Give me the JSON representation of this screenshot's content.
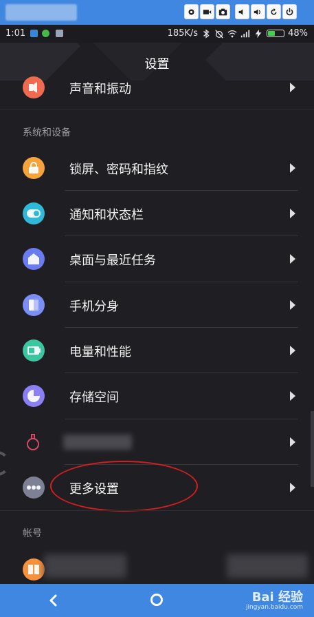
{
  "status_bar": {
    "time": "1:01",
    "network_speed": "185K/s",
    "battery_percent": "48%",
    "battery_level": 0.48
  },
  "header": {
    "title": "设置"
  },
  "items_top": [
    {
      "label": "声音和振动",
      "icon": "speaker-icon",
      "color": "#f06a4f"
    }
  ],
  "sections": [
    {
      "title": "系统和设备",
      "items": [
        {
          "label": "锁屏、密码和指纹",
          "icon": "lock-icon",
          "color": "#f7a33b"
        },
        {
          "label": "通知和状态栏",
          "icon": "toggle-icon",
          "color": "#2fb8d8"
        },
        {
          "label": "桌面与最近任务",
          "icon": "home-icon",
          "color": "#6a7cf0"
        },
        {
          "label": "手机分身",
          "icon": "dual-phone-icon",
          "color": "#7a8ef5"
        },
        {
          "label": "电量和性能",
          "icon": "battery-icon",
          "color": "#3cc6a0"
        },
        {
          "label": "存储空间",
          "icon": "pie-icon",
          "color": "#8a7ff5"
        },
        {
          "label": "",
          "icon": "flask-icon",
          "color": "#d44a6a"
        },
        {
          "label": "更多设置",
          "icon": "more-dots-icon",
          "color": "#7e8094"
        }
      ]
    },
    {
      "title": "帐号"
    }
  ],
  "watermark": {
    "main": "Bai 经验",
    "sub": "jingyan.baidu.com"
  }
}
